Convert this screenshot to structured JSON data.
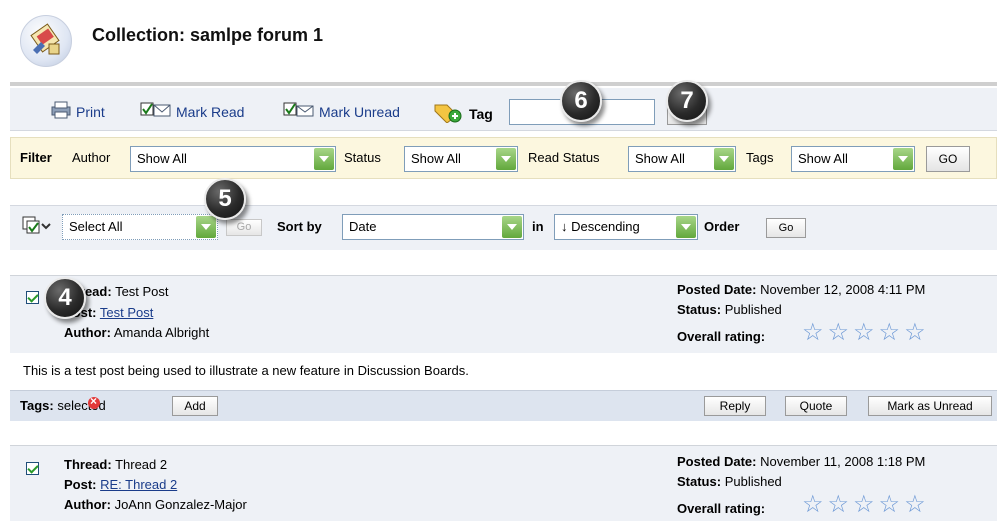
{
  "header": {
    "title": "Collection: samlpe forum 1",
    "icon": "discussion-collection-icon"
  },
  "toolbar": {
    "print": "Print",
    "mark_read": "Mark Read",
    "mark_unread": "Mark Unread",
    "tag_label": "Tag",
    "tag_value": "",
    "go": "Go"
  },
  "filter": {
    "label": "Filter",
    "author_label": "Author",
    "author_value": "Show All",
    "status_label": "Status",
    "status_value": "Show All",
    "read_status_label": "Read Status",
    "read_status_value": "Show All",
    "tags_label": "Tags",
    "tags_value": "Show All",
    "go": "GO"
  },
  "sort": {
    "select_value": "Select All",
    "go_disabled": "Go",
    "sort_by_label": "Sort by",
    "sort_value": "Date",
    "in_label": "in",
    "order_value": "↓ Descending",
    "order_label": "Order",
    "go": "Go"
  },
  "posts": [
    {
      "thread_label": "Thread:",
      "thread": "Test Post",
      "post_label": "Post:",
      "post": "Test Post",
      "author_label": "Author:",
      "author": "Amanda Albright",
      "posted_label": "Posted Date:",
      "posted": "November 12, 2008 4:11 PM",
      "status_label": "Status:",
      "status": "Published",
      "rating_label": "Overall rating:",
      "body": "This is a test post being used to illustrate a new feature in Discussion Boards.",
      "tags_label": "Tags:",
      "tag": "selected",
      "add": "Add",
      "reply": "Reply",
      "quote": "Quote",
      "mark_unread": "Mark as Unread"
    },
    {
      "thread_label": "Thread:",
      "thread": "Thread 2",
      "post_label": "Post:",
      "post": "RE: Thread 2",
      "author_label": "Author:",
      "author": "JoAnn Gonzalez-Major",
      "posted_label": "Posted Date:",
      "posted": "November 11, 2008 1:18 PM",
      "status_label": "Status:",
      "status": "Published",
      "rating_label": "Overall rating:"
    }
  ],
  "callouts": {
    "c4": "4",
    "c5": "5",
    "c6": "6",
    "c7": "7"
  },
  "colors": {
    "toolbar_bg": "#eef1f6",
    "filter_bg": "#fcf7df",
    "link": "#1a3c8a",
    "star": "#6f9ad6"
  }
}
